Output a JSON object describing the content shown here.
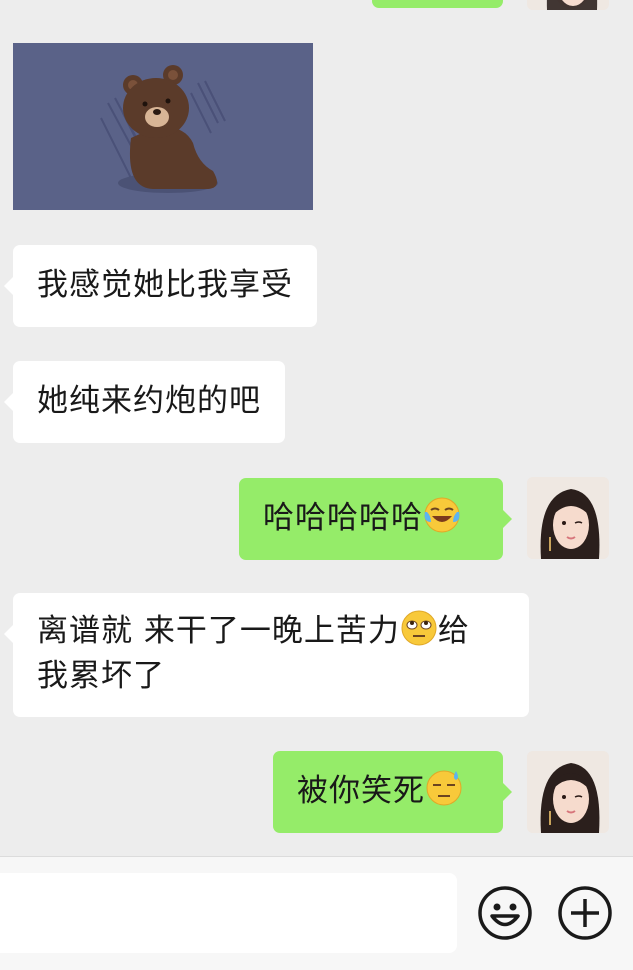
{
  "messages": {
    "m1": {
      "text": "我感觉她比我享受"
    },
    "m2": {
      "text": "她纯来约炮的吧"
    },
    "m3": {
      "text": "哈哈哈哈哈",
      "emoji": "laughing-crying-emoji"
    },
    "m4": {
      "line1": "离谱就 来干了一晚上苦力",
      "line1_end": "给",
      "line2": "我累坏了",
      "emoji": "eye-roll-emoji"
    },
    "m5": {
      "text": "被你笑死",
      "emoji": "sweat-emoji"
    }
  },
  "sticker": {
    "icon": "brown-bear-sticker"
  },
  "toolbar": {
    "emoji_icon": "smiley-icon",
    "more_icon": "plus-icon"
  },
  "colors": {
    "background": "#ededed",
    "incoming_bubble": "#ffffff",
    "outgoing_bubble": "#95ec69",
    "sticker_bg": "#5a6288"
  }
}
